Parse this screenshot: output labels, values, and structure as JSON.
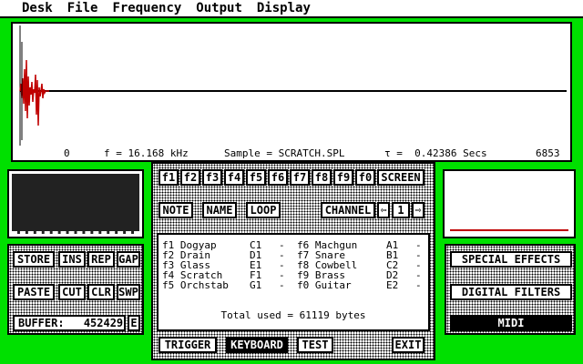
{
  "menu": [
    "Desk",
    "File",
    "Frequency",
    "Output",
    "Display"
  ],
  "status": {
    "position": "0",
    "frequency": "f = 16.168 kHz",
    "sample": "Sample = SCRATCH.SPL",
    "time": "τ =  0.42386 Secs",
    "length": "6853"
  },
  "fkeys": [
    "f1",
    "f2",
    "f3",
    "f4",
    "f5",
    "f6",
    "f7",
    "f8",
    "f9",
    "f0"
  ],
  "screen_label": "SCREEN",
  "note_label": "NOTE",
  "name_label": "NAME",
  "loop_label": "LOOP",
  "channel_label": "CHANNEL",
  "channel_value": "1",
  "slots_left": [
    {
      "key": "f1",
      "name": "Dogyap",
      "note": "C1",
      "dash": "-"
    },
    {
      "key": "f2",
      "name": "Drain",
      "note": "D1",
      "dash": "-"
    },
    {
      "key": "f3",
      "name": "Glass",
      "note": "E1",
      "dash": "-"
    },
    {
      "key": "f4",
      "name": "Scratch",
      "note": "F1",
      "dash": "-"
    },
    {
      "key": "f5",
      "name": "Orchstab",
      "note": "G1",
      "dash": "-"
    }
  ],
  "slots_right": [
    {
      "key": "f6",
      "name": "Machgun",
      "note": "A1",
      "dash": "-"
    },
    {
      "key": "f7",
      "name": "Snare",
      "note": "B1",
      "dash": "-"
    },
    {
      "key": "f8",
      "name": "Cowbell",
      "note": "C2",
      "dash": "-"
    },
    {
      "key": "f9",
      "name": "Brass",
      "note": "D2",
      "dash": "-"
    },
    {
      "key": "f0",
      "name": "Guitar",
      "note": "E2",
      "dash": "-"
    }
  ],
  "total_used": "Total used = 61119 bytes",
  "bottom_buttons": {
    "trigger": "TRIGGER",
    "keyboard": "KEYBOARD",
    "test": "TEST",
    "exit": "EXIT"
  },
  "edit_buttons": {
    "store": "STORE",
    "ins": "INS",
    "rep": "REP",
    "gap": "GAP",
    "paste": "PASTE",
    "cut": "CUT",
    "clr": "CLR",
    "swp": "SWP"
  },
  "buffer_label": "BUFFER:",
  "buffer_value": "452429",
  "buffer_unit": "E",
  "right_buttons": {
    "special": "SPECIAL  EFFECTS",
    "filters": "DIGITAL  FILTERS",
    "midi": "MIDI"
  },
  "colors": {
    "desktop": "#00e000",
    "waveform": "#c00000",
    "window": "#ffffff"
  }
}
